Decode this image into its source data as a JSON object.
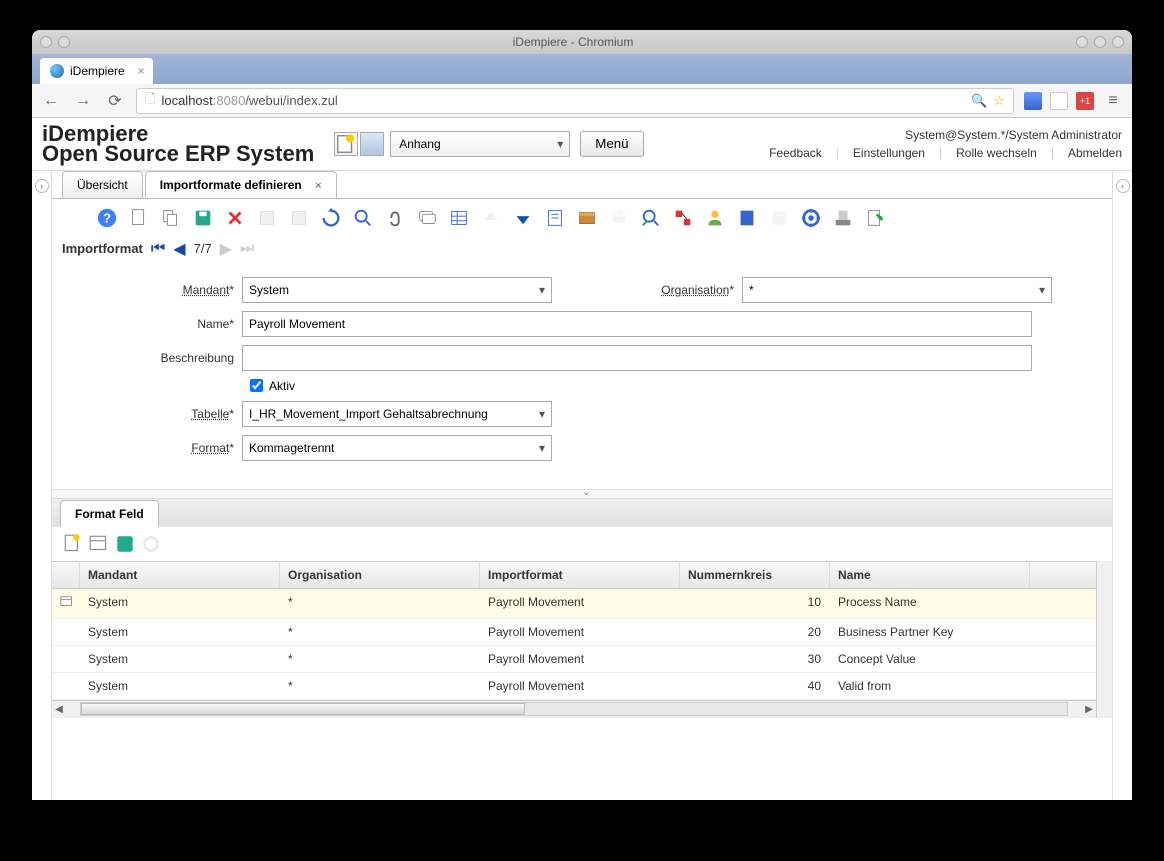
{
  "window_title": "iDempiere - Chromium",
  "browser_tab": "iDempiere",
  "url_host": "localhost",
  "url_port": ":8080",
  "url_path": "/webui/index.zul",
  "logo_main": "iDempiere",
  "logo_sub": "Open Source   ERP System",
  "anhang_label": "Anhang",
  "menu_button": "Menü",
  "user_context": "System@System.*/System Administrator",
  "header_links": {
    "feedback": "Feedback",
    "settings": "Einstellungen",
    "role": "Rolle wechseln",
    "logout": "Abmelden"
  },
  "page_tabs": {
    "overview": "Übersicht",
    "define": "Importformate definieren"
  },
  "record": {
    "title": "Importformat",
    "position": "7/7"
  },
  "form": {
    "mandant_label": "Mandant",
    "mandant_value": "System",
    "org_label": "Organisation",
    "org_value": "*",
    "name_label": "Name",
    "name_value": "Payroll Movement",
    "desc_label": "Beschreibung",
    "desc_value": "",
    "active_label": "Aktiv",
    "active_checked": true,
    "table_label": "Tabelle",
    "table_value": "I_HR_Movement_Import Gehaltsabrechnung",
    "format_label": "Format",
    "format_value": "Kommagetrennt"
  },
  "subtab_label": "Format Feld",
  "grid": {
    "headers": {
      "mandant": "Mandant",
      "org": "Organisation",
      "format": "Importformat",
      "num": "Nummernkreis",
      "name": "Name"
    },
    "rows": [
      {
        "mandant": "System",
        "org": "*",
        "format": "Payroll Movement",
        "num": "10",
        "name": "Process Name",
        "selected": true
      },
      {
        "mandant": "System",
        "org": "*",
        "format": "Payroll Movement",
        "num": "20",
        "name": "Business Partner Key",
        "selected": false
      },
      {
        "mandant": "System",
        "org": "*",
        "format": "Payroll Movement",
        "num": "30",
        "name": "Concept Value",
        "selected": false
      },
      {
        "mandant": "System",
        "org": "*",
        "format": "Payroll Movement",
        "num": "40",
        "name": "Valid from",
        "selected": false
      }
    ]
  }
}
